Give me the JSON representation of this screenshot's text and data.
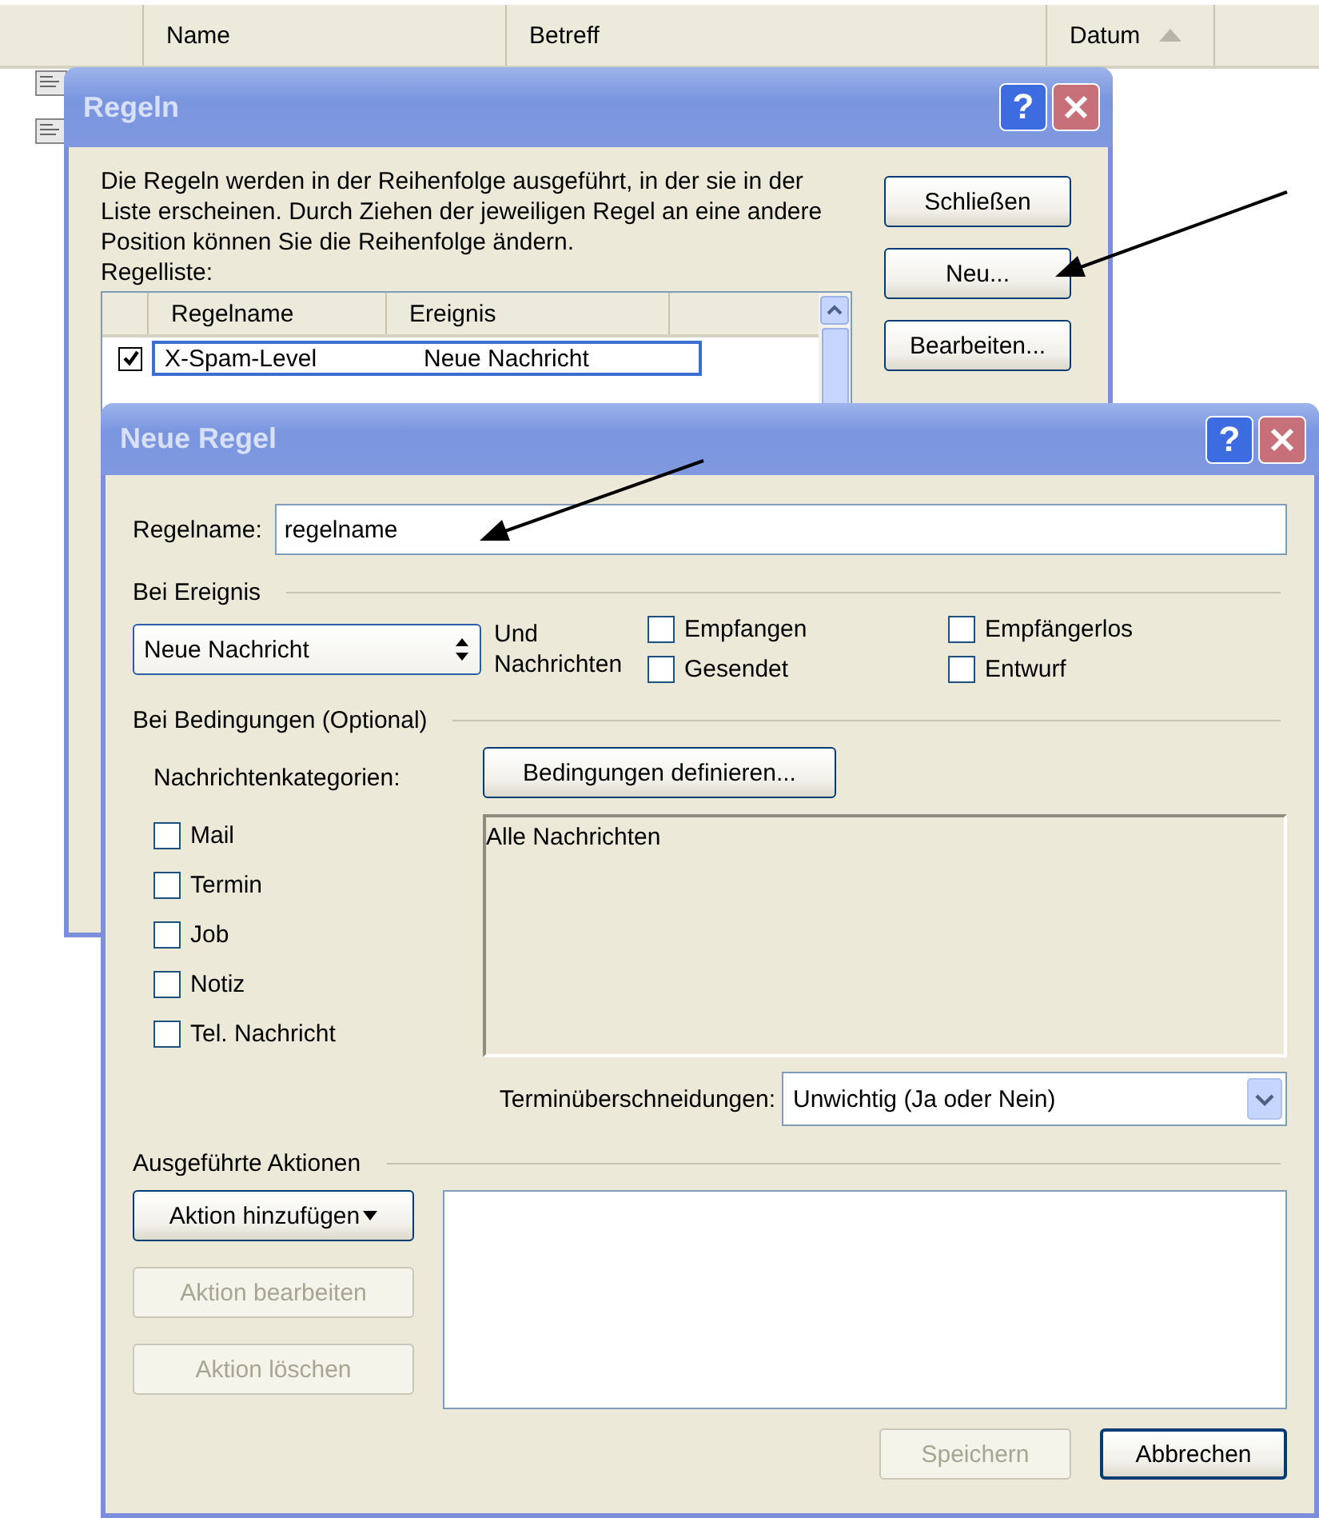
{
  "list_header": {
    "columns": [
      {
        "label": "Name",
        "sorted": false
      },
      {
        "label": "Betreff",
        "sorted": false
      },
      {
        "label": "Datum",
        "sorted": true
      }
    ]
  },
  "regeln_window": {
    "title": "Regeln",
    "help_button": "?",
    "description": "Die Regeln werden in der Reihenfolge ausgeführt, in der sie in der Liste erscheinen. Durch Ziehen der jeweiligen Regel an eine andere Position können Sie die Reihenfolge ändern.",
    "list_label": "Regelliste:",
    "rule_list": {
      "columns": [
        "Regelname",
        "Ereignis"
      ],
      "rows": [
        {
          "checked": true,
          "selected": true,
          "name": "X-Spam-Level",
          "event": "Neue Nachricht"
        }
      ]
    },
    "buttons": [
      "Schließen",
      "Neu...",
      "Bearbeiten..."
    ]
  },
  "neue_regel_window": {
    "title": "Neue Regel",
    "help_button": "?",
    "rule_name": {
      "label": "Regelname:",
      "value": "regelname"
    },
    "event_section": {
      "title": "Bei Ereignis",
      "event_select": "Neue Nachricht",
      "messages_label": "Und Nachrichten",
      "checkboxes": [
        {
          "label": "Empfangen",
          "checked": false
        },
        {
          "label": "Gesendet",
          "checked": false
        },
        {
          "label": "Empfängerlos",
          "checked": false
        },
        {
          "label": "Entwurf",
          "checked": false
        }
      ]
    },
    "conditions_section": {
      "title": "Bei Bedingungen  (Optional)",
      "categories_label": "Nachrichtenkategorien:",
      "define_button": "Bedingungen definieren...",
      "categories": [
        {
          "label": "Mail",
          "checked": false
        },
        {
          "label": "Termin",
          "checked": false
        },
        {
          "label": "Job",
          "checked": false
        },
        {
          "label": "Notiz",
          "checked": false
        },
        {
          "label": "Tel. Nachricht",
          "checked": false
        }
      ],
      "conditions_text": "Alle Nachrichten",
      "overlap": {
        "label": "Terminüberschneidungen:",
        "value": "Unwichtig (Ja oder Nein)"
      }
    },
    "actions_section": {
      "title": "Ausgeführte Aktionen",
      "buttons": [
        {
          "label": "Aktion hinzufügen",
          "kind": "dropdown",
          "disabled": false
        },
        {
          "label": "Aktion bearbeiten",
          "kind": "plain",
          "disabled": true
        },
        {
          "label": "Aktion löschen",
          "kind": "plain",
          "disabled": true
        }
      ]
    },
    "footer_buttons": [
      {
        "label": "Speichern",
        "disabled": true
      },
      {
        "label": "Abbrechen",
        "disabled": false
      }
    ]
  }
}
